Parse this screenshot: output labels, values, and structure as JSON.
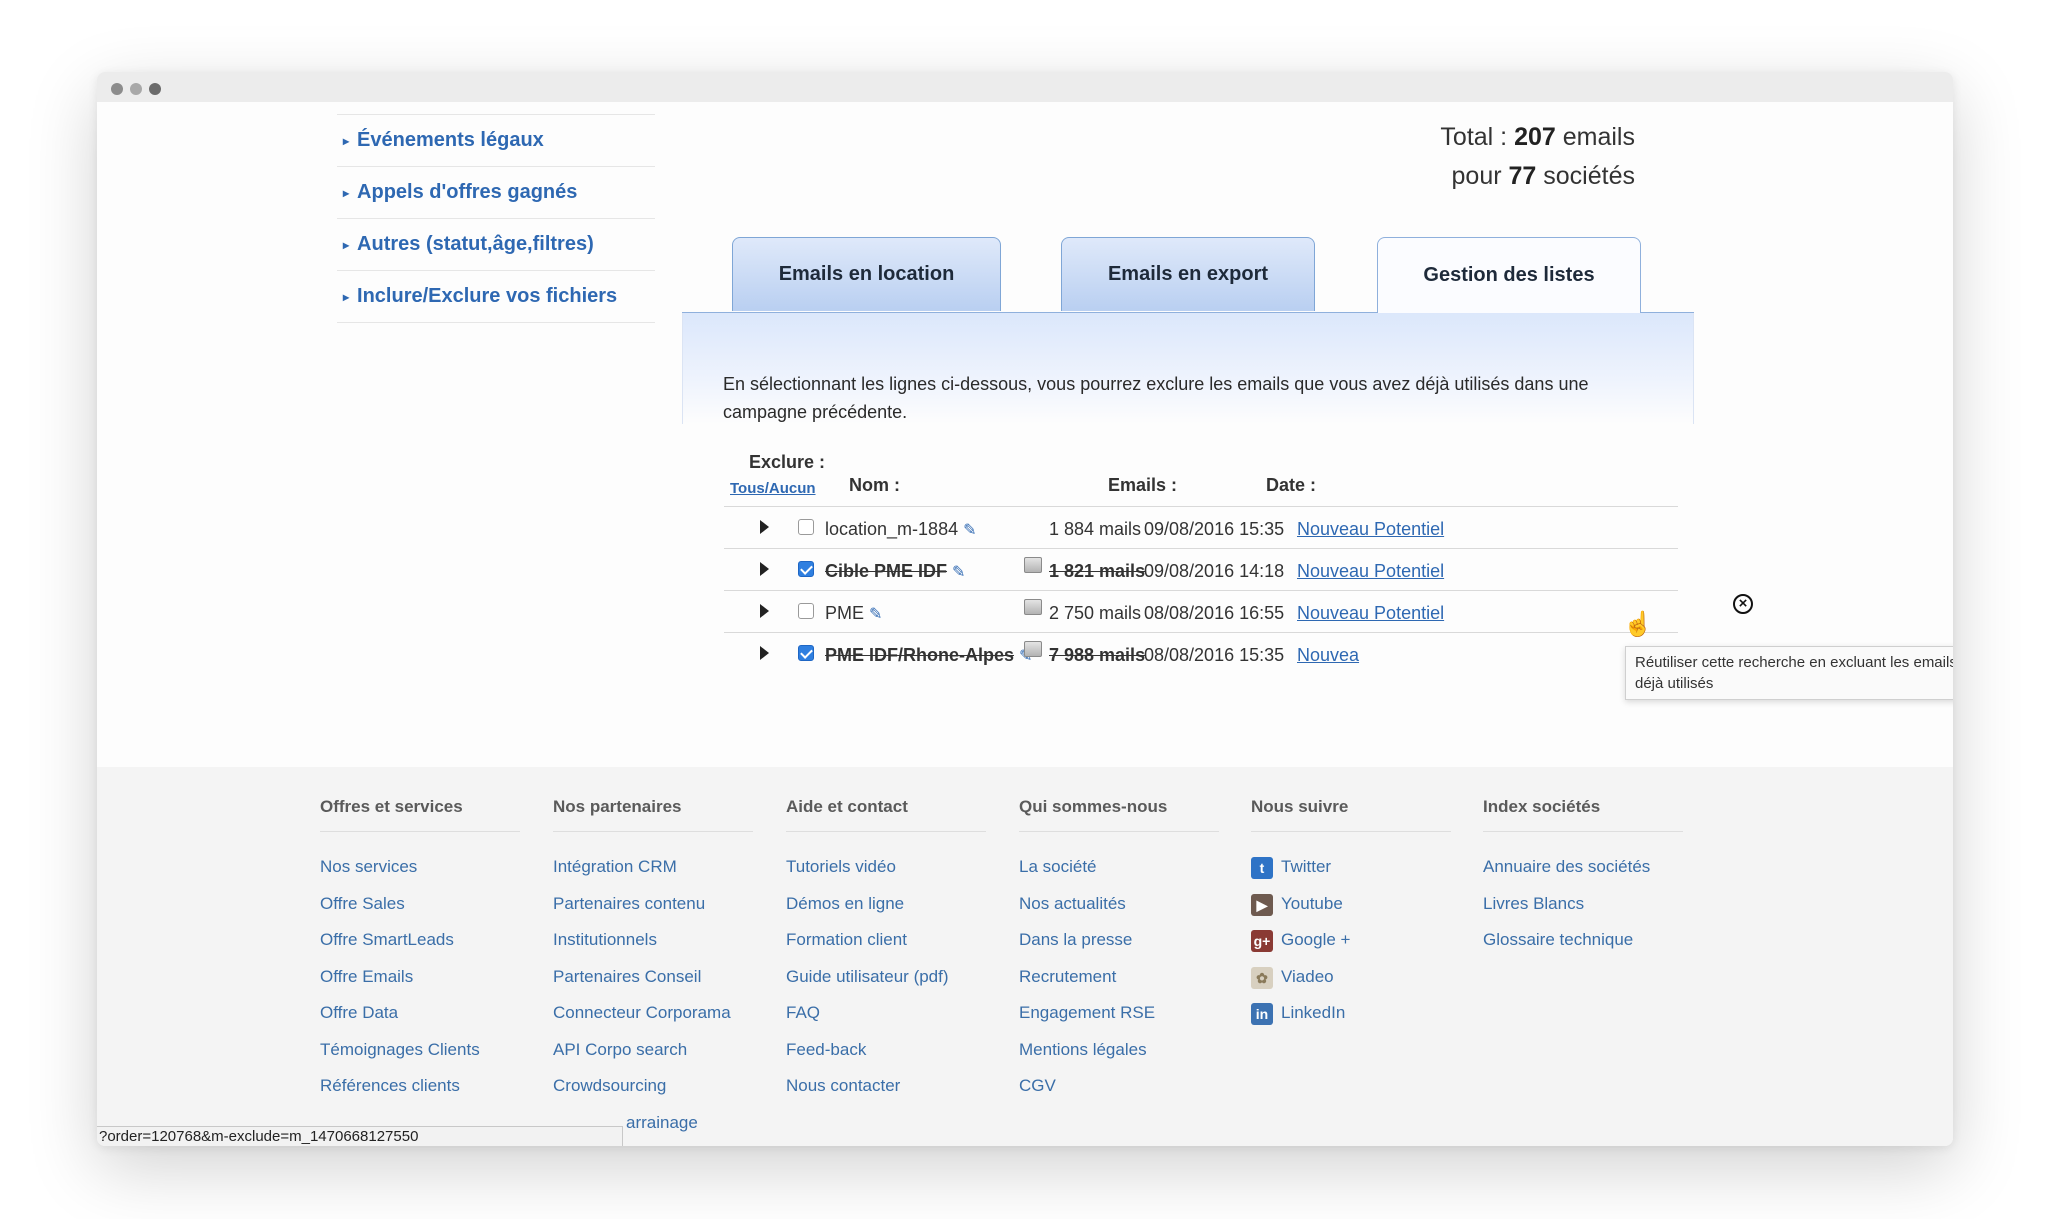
{
  "sidebar": {
    "items": [
      {
        "label": "Événements légaux"
      },
      {
        "label": "Appels d'offres gagnés"
      },
      {
        "label": "Autres (statut,âge,filtres)"
      },
      {
        "label": "Inclure/Exclure vos fichiers"
      }
    ]
  },
  "summary": {
    "line1_prefix": "Total :",
    "emails_count": "207",
    "line1_suffix": "emails",
    "line2_prefix": "pour",
    "companies_count": "77",
    "line2_suffix": "sociétés"
  },
  "tabs": [
    {
      "label": "Emails en location",
      "active": false
    },
    {
      "label": "Emails en export",
      "active": false
    },
    {
      "label": "Gestion des listes",
      "active": true
    }
  ],
  "panel": {
    "intro": "En sélectionnant les lignes ci-dessous, vous pourrez exclure les emails que vous avez déjà utilisés dans une campagne précédente."
  },
  "table": {
    "exclude_label": "Exclure :",
    "toggle_all": "Tous/Aucun",
    "headers": {
      "name": "Nom :",
      "emails": "Emails :",
      "date": "Date :"
    },
    "rows": [
      {
        "name": "location_m-1884",
        "emails": "1 884 mails",
        "date": "09/08/2016 15:35",
        "action": "Nouveau Potentiel",
        "checked": false
      },
      {
        "name": "Cible PME IDF",
        "emails": "1 821 mails",
        "date": "09/08/2016 14:18",
        "action": "Nouveau Potentiel",
        "checked": true
      },
      {
        "name": "PME",
        "emails": "2 750 mails",
        "date": "08/08/2016 16:55",
        "action": "Nouveau Potentiel",
        "checked": false
      },
      {
        "name": "PME IDF/Rhone-Alpes",
        "emails": "7 988 mails",
        "date": "08/08/2016 15:35",
        "action": "Nouvea",
        "checked": true
      }
    ]
  },
  "tooltip": {
    "text": "Réutiliser cette recherche en excluant les emails déjà utilisés"
  },
  "footer": {
    "columns": [
      {
        "title": "Offres et services",
        "links": [
          "Nos services",
          "Offre Sales",
          "Offre SmartLeads",
          "Offre Emails",
          "Offre Data",
          "Témoignages Clients",
          "Références clients"
        ]
      },
      {
        "title": "Nos partenaires",
        "links": [
          "Intégration CRM",
          "Partenaires contenu",
          "Institutionnels",
          "Partenaires Conseil",
          "Connecteur Corporama",
          "API Corpo search",
          "Crowdsourcing",
          "arrainage"
        ]
      },
      {
        "title": "Aide et contact",
        "links": [
          "Tutoriels vidéo",
          "Démos en ligne",
          "Formation client",
          "Guide utilisateur (pdf)",
          "FAQ",
          "Feed-back",
          "Nous contacter"
        ]
      },
      {
        "title": "Qui sommes-nous",
        "links": [
          "La société",
          "Nos actualités",
          "Dans la presse",
          "Recrutement",
          "Engagement RSE",
          "Mentions légales",
          "CGV"
        ]
      },
      {
        "title": "Nous suivre",
        "links": [
          "Twitter",
          "Youtube",
          "Google +",
          "Viadeo",
          "LinkedIn"
        ],
        "icons": [
          "twitter-icon",
          "youtube-icon",
          "google-plus-icon",
          "viadeo-icon",
          "linkedin-icon"
        ]
      },
      {
        "title": "Index sociétés",
        "links": [
          "Annuaire des sociétés",
          "Livres Blancs",
          "Glossaire technique"
        ]
      }
    ]
  },
  "status_bar": {
    "url": "?order=120768&m-exclude=m_1470668127550"
  }
}
